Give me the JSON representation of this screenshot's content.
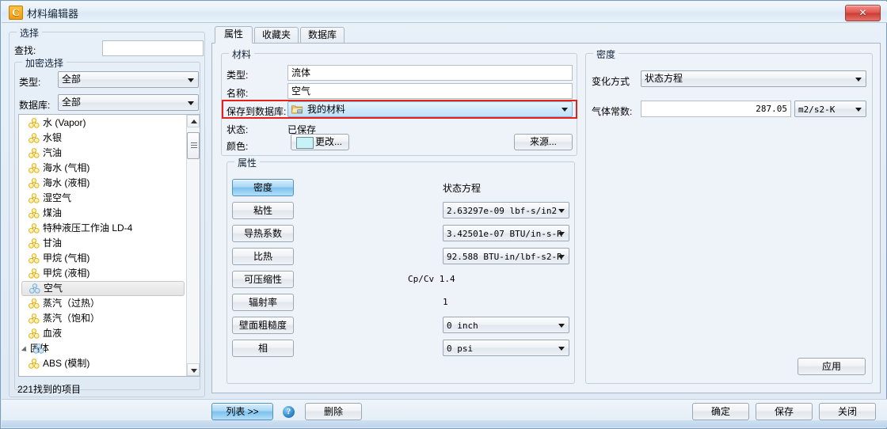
{
  "window": {
    "title": "材料编辑器",
    "icon": "app-c-icon",
    "close_label": "✕"
  },
  "left_panel": {
    "select_group_title": "选择",
    "find_label": "查找:",
    "find_value": "",
    "refine_group_title": "加密选择",
    "type_label": "类型:",
    "type_value": "全部",
    "database_label": "数据库:",
    "database_value": "全部",
    "status_text": "221找到的项目",
    "tree_items": [
      {
        "label": "水 (Vapor)",
        "level": 1,
        "selected": false,
        "icon": "molecule-icon"
      },
      {
        "label": "水银",
        "level": 1,
        "selected": false,
        "icon": "molecule-icon"
      },
      {
        "label": "汽油",
        "level": 1,
        "selected": false,
        "icon": "molecule-icon"
      },
      {
        "label": "海水 (气相)",
        "level": 1,
        "selected": false,
        "icon": "molecule-icon"
      },
      {
        "label": "海水 (液相)",
        "level": 1,
        "selected": false,
        "icon": "molecule-icon"
      },
      {
        "label": "湿空气",
        "level": 1,
        "selected": false,
        "icon": "molecule-icon"
      },
      {
        "label": "煤油",
        "level": 1,
        "selected": false,
        "icon": "molecule-icon"
      },
      {
        "label": "特种液压工作油 LD-4",
        "level": 1,
        "selected": false,
        "icon": "molecule-icon"
      },
      {
        "label": "甘油",
        "level": 1,
        "selected": false,
        "icon": "molecule-icon"
      },
      {
        "label": "甲烷 (气相)",
        "level": 1,
        "selected": false,
        "icon": "molecule-icon"
      },
      {
        "label": "甲烷 (液相)",
        "level": 1,
        "selected": false,
        "icon": "molecule-icon"
      },
      {
        "label": "空气",
        "level": 1,
        "selected": true,
        "icon": "molecule-icon"
      },
      {
        "label": "蒸汽（过热）",
        "level": 1,
        "selected": false,
        "icon": "molecule-icon"
      },
      {
        "label": "蒸汽（饱和）",
        "level": 1,
        "selected": false,
        "icon": "molecule-icon"
      },
      {
        "label": "血液",
        "level": 1,
        "selected": false,
        "icon": "molecule-icon"
      },
      {
        "label": "固体",
        "level": 0,
        "selected": false,
        "icon": "molecule-group-icon",
        "expander": true
      },
      {
        "label": "ABS (模制)",
        "level": 1,
        "selected": false,
        "icon": "molecule-icon"
      }
    ]
  },
  "tabs": [
    {
      "label": "属性",
      "active": true
    },
    {
      "label": "收藏夹",
      "active": false
    },
    {
      "label": "数据库",
      "active": false
    }
  ],
  "material_group": {
    "title": "材料",
    "type_label": "类型:",
    "type_value": "流体",
    "name_label": "名称:",
    "name_value": "空气",
    "save_to_db_label": "保存到数据库:",
    "save_to_db_value": "我的材料",
    "save_to_db_icon": "folder-database-icon",
    "state_label": "状态:",
    "state_value": "已保存",
    "color_label": "颜色:",
    "color_change_button": "更改...",
    "color_swatch_hex": "#c7f2f7",
    "source_button": "来源...",
    "highlight_hex": "#e8201a"
  },
  "properties_group": {
    "title": "属性",
    "column_header": "状态方程",
    "rows": [
      {
        "button": "密度",
        "active": true,
        "value": "",
        "kind": "none"
      },
      {
        "button": "粘性",
        "active": false,
        "value": "2.63297e-09 lbf-s/in2",
        "kind": "combo"
      },
      {
        "button": "导热系数",
        "active": false,
        "value": "3.42501e-07 BTU/in-s-R",
        "kind": "combo"
      },
      {
        "button": "比热",
        "active": false,
        "value": "92.588 BTU-in/lbf-s2-R",
        "kind": "combo"
      },
      {
        "button": "可压缩性",
        "active": false,
        "value": "Cp/Cv 1.4",
        "kind": "text"
      },
      {
        "button": "辐射率",
        "active": false,
        "value": "1",
        "kind": "text"
      },
      {
        "button": "壁面粗糙度",
        "active": false,
        "value": "0 inch",
        "kind": "combo"
      },
      {
        "button": "相",
        "active": false,
        "value": "0 psi",
        "kind": "combo"
      }
    ]
  },
  "density_group": {
    "title": "密度",
    "variation_label": "变化方式",
    "variation_value": "状态方程",
    "gas_constant_label": "气体常数:",
    "gas_constant_value": "287.05",
    "gas_constant_unit": "m2/s2-K",
    "apply_button": "应用"
  },
  "footer": {
    "list_button": "列表 >>",
    "help_icon": "help-icon",
    "delete_button": "删除",
    "ok_button": "确定",
    "save_button": "保存",
    "close_button": "关闭"
  }
}
